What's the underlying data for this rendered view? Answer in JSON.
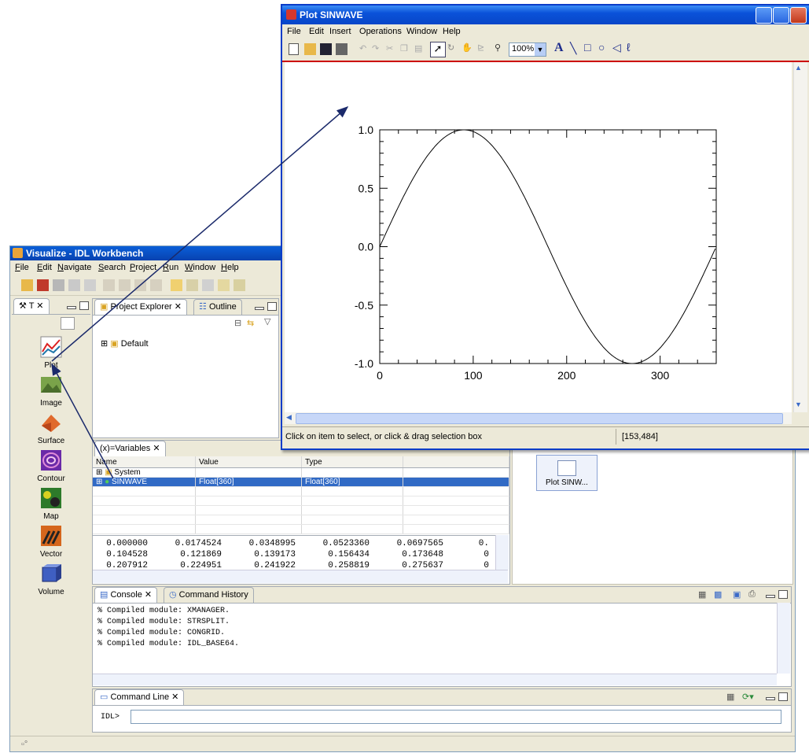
{
  "workbench": {
    "title": "Visualize - IDL Workbench",
    "menu": [
      "File",
      "Edit",
      "Navigate",
      "Search",
      "Project",
      "Run",
      "Window",
      "Help"
    ],
    "tools_tab": "T",
    "tools": [
      {
        "label": "Plot",
        "icon": "plot-icon"
      },
      {
        "label": "Image",
        "icon": "image-icon"
      },
      {
        "label": "Surface",
        "icon": "surface-icon"
      },
      {
        "label": "Contour",
        "icon": "contour-icon"
      },
      {
        "label": "Map",
        "icon": "map-icon"
      },
      {
        "label": "Vector",
        "icon": "vector-icon"
      },
      {
        "label": "Volume",
        "icon": "volume-icon"
      }
    ],
    "project_explorer_tab": "Project Explorer",
    "outline_tab": "Outline",
    "project_tree": [
      {
        "label": "Default"
      }
    ],
    "variables_tab": "Variables",
    "variables_columns": [
      "Name",
      "Value",
      "Type"
    ],
    "variables_rows": [
      {
        "name": "System",
        "value": "",
        "type": ""
      },
      {
        "name": "SINWAVE",
        "value": "Float[360]",
        "type": "Float[360]"
      }
    ],
    "variable_values": [
      [
        "0.000000",
        "0.0174524",
        "0.0348995",
        "0.0523360",
        "0.0697565",
        "0."
      ],
      [
        "0.104528",
        "0.121869",
        "0.139173",
        "0.156434",
        "0.173648",
        "0"
      ],
      [
        "0.207912",
        "0.224951",
        "0.241922",
        "0.258819",
        "0.275637",
        "0"
      ]
    ],
    "visual_item": "Plot SINW...",
    "console_tab": "Console",
    "command_history_tab": "Command History",
    "console_lines": [
      "% Compiled module: XMANAGER.",
      "% Compiled module: STRSPLIT.",
      "% Compiled module: CONGRID.",
      "% Compiled module: IDL_BASE64."
    ],
    "command_line_tab": "Command Line",
    "prompt": "IDL>",
    "command_value": ""
  },
  "plot_window": {
    "title": "Plot SINWAVE",
    "menu": [
      "File",
      "Edit",
      "Insert",
      "Operations",
      "Window",
      "Help"
    ],
    "zoom": "100%",
    "status": "Click on item to select, or click & drag selection box",
    "coords": "[153,484]"
  },
  "chart_data": {
    "type": "line",
    "title": "",
    "xlabel": "",
    "ylabel": "",
    "xlim": [
      0,
      360
    ],
    "ylim": [
      -1.0,
      1.0
    ],
    "xticks": [
      "0",
      "100",
      "200",
      "300"
    ],
    "yticks": [
      "1.0",
      "0.5",
      "0.0",
      "-0.5",
      "-1.0"
    ],
    "grid": false,
    "series": [
      {
        "x_start": 0,
        "x_end": 359,
        "x_step": 1,
        "function": "sin(x degrees)"
      }
    ]
  },
  "colors": {
    "xp_blue": "#0a52d9",
    "selection": "#316ac5",
    "plot_line": "#000000",
    "arrow": "#1b2a6b"
  }
}
